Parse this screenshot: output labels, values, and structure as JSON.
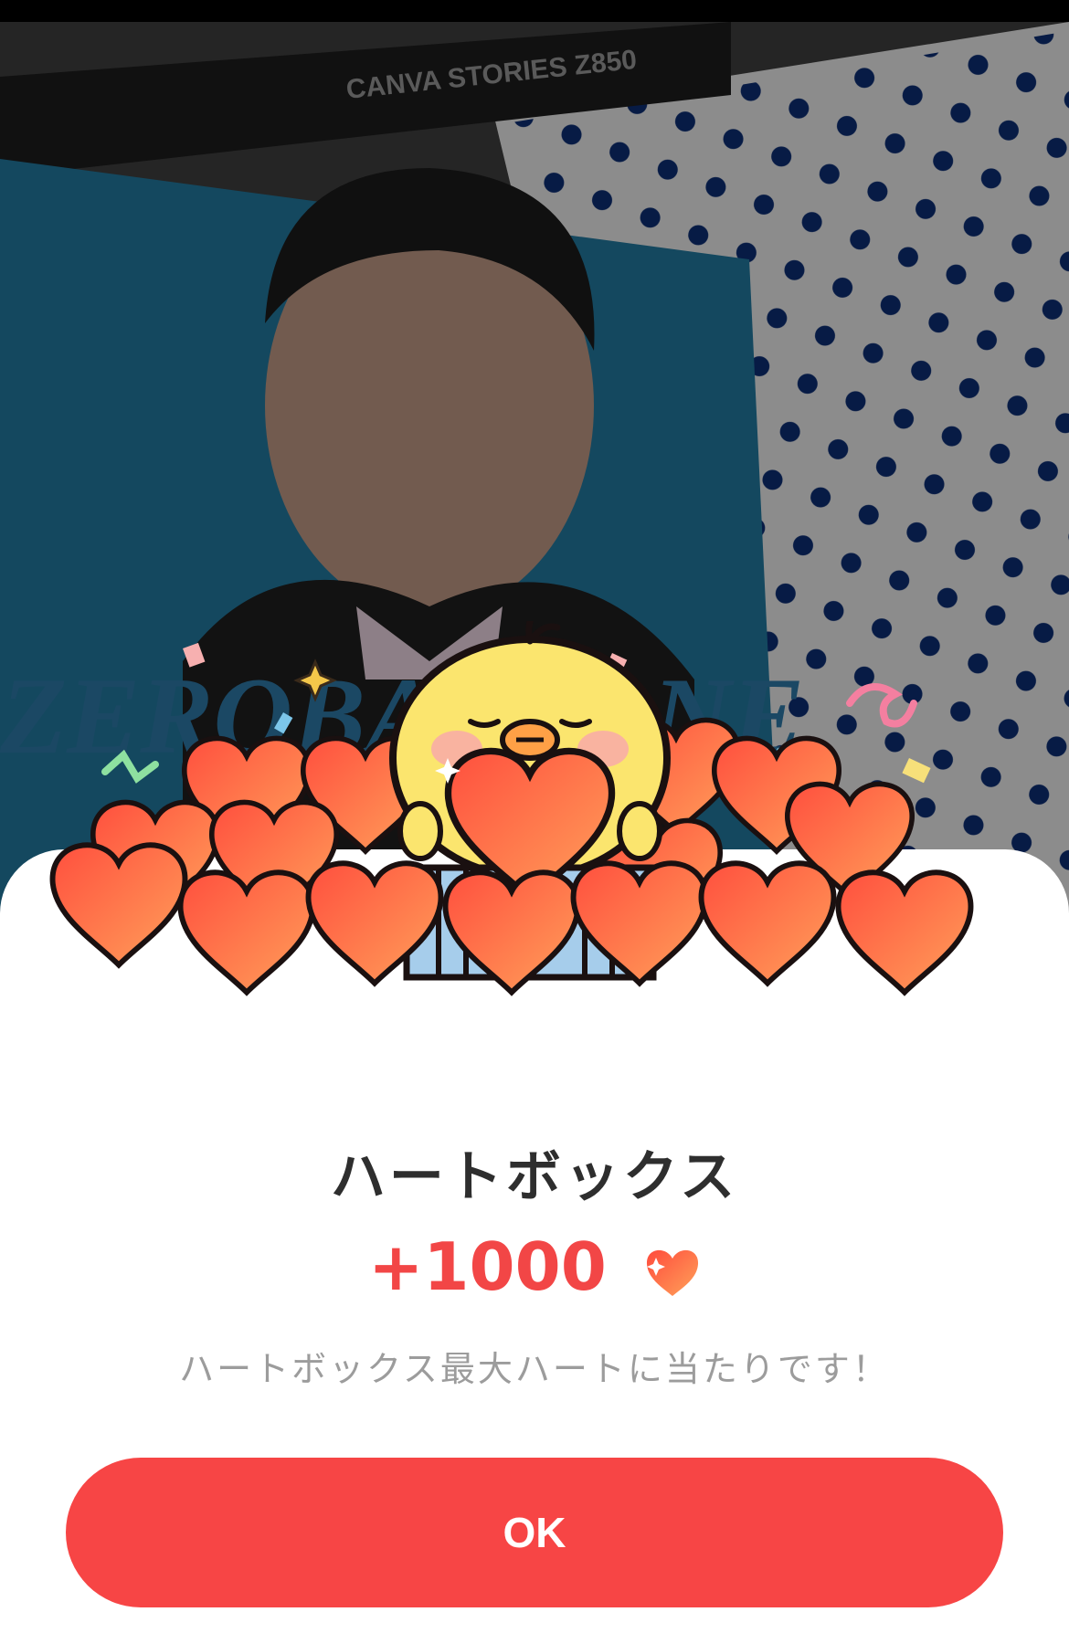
{
  "background": {
    "banner_text": "CANVA STORIES Z850",
    "logo_text": "ZEROBASEONE"
  },
  "dialog": {
    "title": "ハートボックス",
    "reward_amount": "+1000",
    "reward_icon": "heart-icon",
    "description": "ハートボックス最大ハートに当たりです！",
    "ok_label": "OK"
  },
  "colors": {
    "accent": "#f74545",
    "reward_text": "#f24646",
    "heart_fill": "#ff6a4c"
  }
}
